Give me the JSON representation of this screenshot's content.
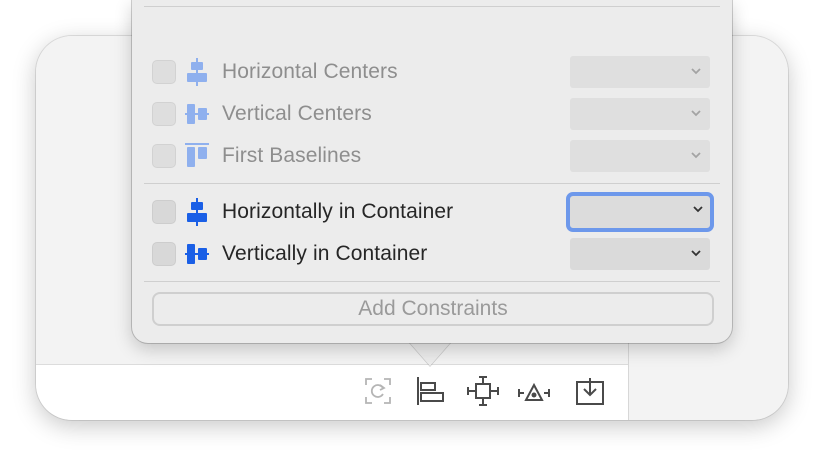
{
  "popover": {
    "rows_dim": [
      {
        "label": "Horizontal Centers",
        "icon": "align-horizontal-centers-icon"
      },
      {
        "label": "Vertical Centers",
        "icon": "align-vertical-centers-icon"
      },
      {
        "label": "First Baselines",
        "icon": "align-first-baselines-icon"
      }
    ],
    "rows_active": [
      {
        "label": "Horizontally in Container",
        "icon": "center-horizontally-in-container-icon"
      },
      {
        "label": "Vertically in Container",
        "icon": "center-vertically-in-container-icon"
      }
    ],
    "add_button_label": "Add Constraints"
  },
  "toolbar": {
    "icons": [
      "update-frames-icon",
      "align-icon",
      "add-new-constraints-icon",
      "resolve-auto-layout-issues-icon",
      "embed-in-icon"
    ]
  },
  "colors": {
    "accent": "#1a5fe6",
    "accent_dim": "#8fb0ee",
    "focus_ring": "#6d98eb"
  }
}
